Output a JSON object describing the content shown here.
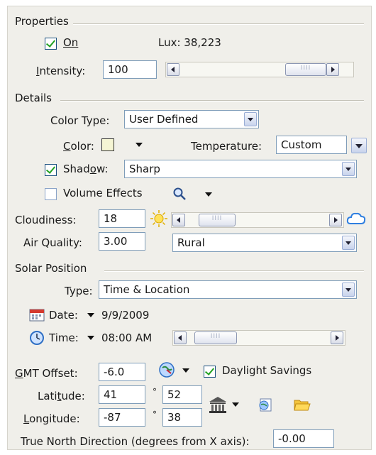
{
  "properties": {
    "title": "Properties",
    "on_label": "On",
    "on_checked": true,
    "lux_text": "Lux: 38,223",
    "intensity_label": "Intensity:",
    "intensity_value": "100"
  },
  "details": {
    "title": "Details",
    "color_type_label": "Color Type:",
    "color_type_value": "User Defined",
    "color_label": "Color:",
    "color_swatch": "#f5f5d4",
    "temperature_label": "Temperature:",
    "temperature_value": "Custom",
    "shadow_label": "Shadow:",
    "shadow_checked": true,
    "shadow_value": "Sharp",
    "volume_effects_label": "Volume Effects",
    "volume_effects_checked": false,
    "cloudiness_label": "Cloudiness:",
    "cloudiness_value": "18",
    "air_quality_label": "Air Quality:",
    "air_quality_value": "3.00",
    "air_quality_preset": "Rural"
  },
  "solar": {
    "title": "Solar Position",
    "type_label": "Type:",
    "type_value": "Time & Location",
    "date_label": "Date:",
    "date_value": "9/9/2009",
    "time_label": "Time:",
    "time_value": "08:00 AM",
    "gmt_label": "GMT Offset:",
    "gmt_value": "-6.0",
    "daylight_label": "Daylight Savings",
    "daylight_checked": true,
    "latitude_label": "Latitude:",
    "latitude_deg": "41",
    "latitude_min": "52",
    "longitude_label": "Longitude:",
    "longitude_deg": "-87",
    "longitude_min": "38",
    "degree_symbol": "°",
    "true_north_label": "True North Direction (degrees from X axis):",
    "true_north_value": "-0.00"
  }
}
